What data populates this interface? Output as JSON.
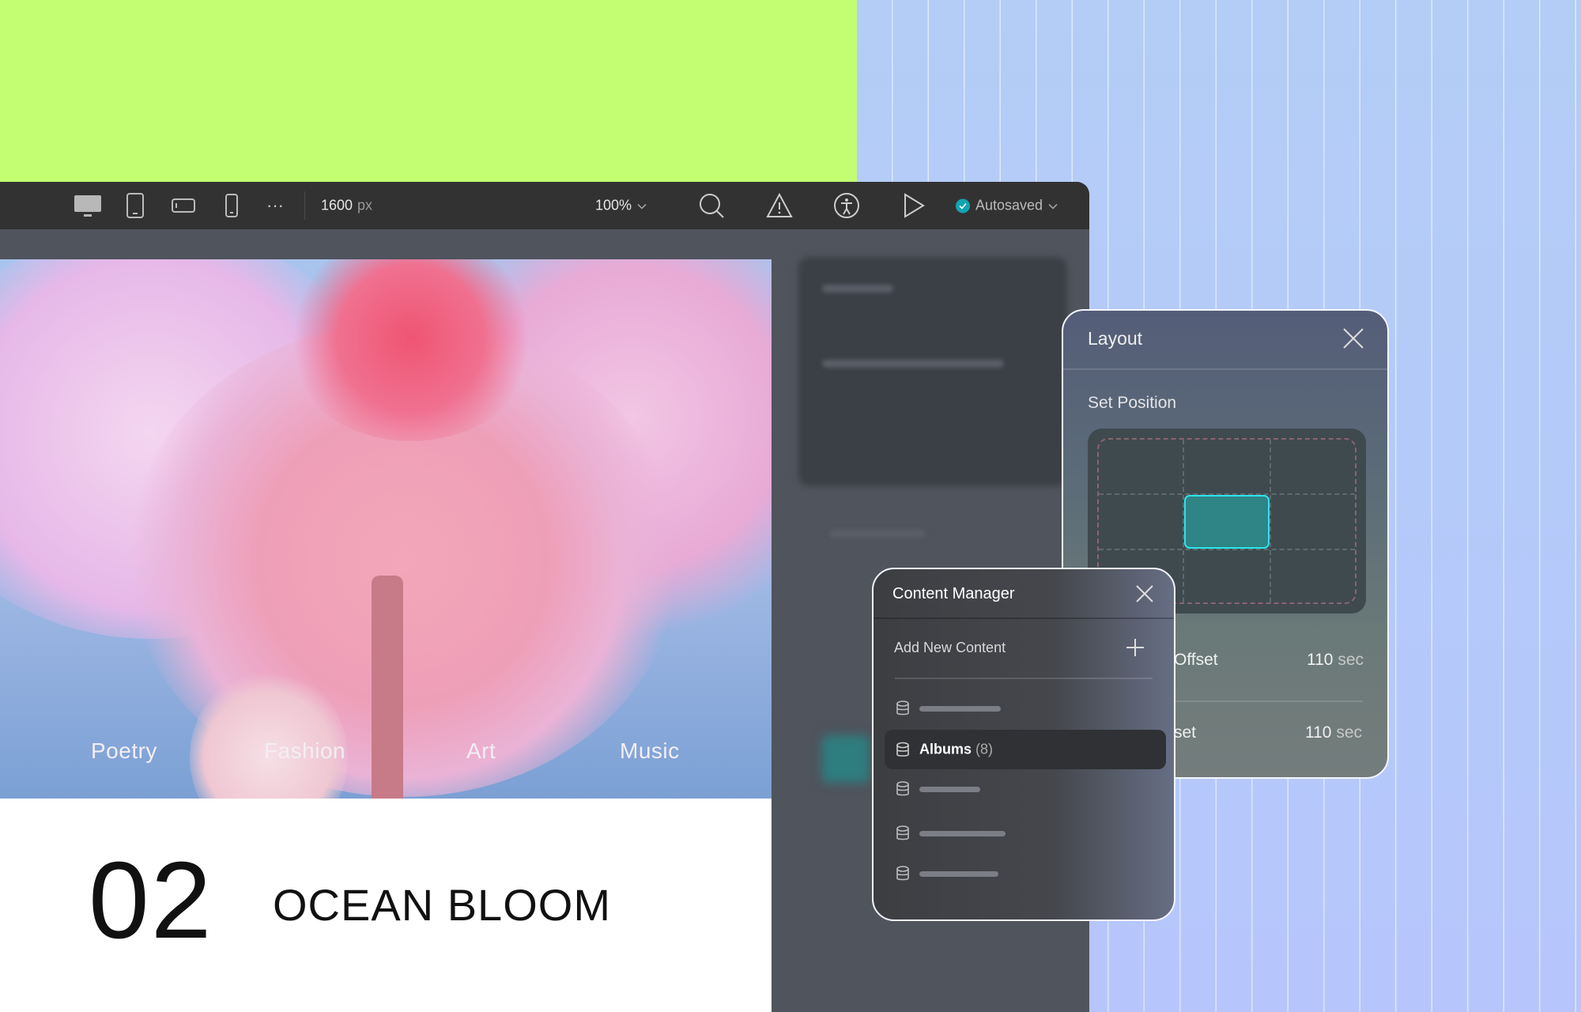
{
  "toolbar": {
    "devices": [
      "desktop-icon",
      "tablet-icon",
      "tablet-landscape-icon",
      "mobile-icon"
    ],
    "width_value": "1600",
    "width_unit": "px",
    "zoom": "100%",
    "status": "Autosaved",
    "status_color": "#13a3b0"
  },
  "hero": {
    "nav": [
      "Poetry",
      "Fashion",
      "Art",
      "Music"
    ],
    "number": "02",
    "title": "OCEAN BLOOM"
  },
  "layout_panel": {
    "title": "Layout",
    "section": "Set Position",
    "selected_cell": "center",
    "rows": [
      {
        "label": "Offset",
        "value": "110",
        "unit": "sec"
      },
      {
        "label": "set",
        "value": "110",
        "unit": "sec"
      }
    ]
  },
  "content_manager": {
    "title": "Content Manager",
    "add_label": "Add New Content",
    "selected_item": {
      "label": "Albums",
      "count": "(8)"
    }
  },
  "colors": {
    "accent": "#2de3e9",
    "green": "#c3fd72",
    "blue": "#b7c8fb"
  }
}
